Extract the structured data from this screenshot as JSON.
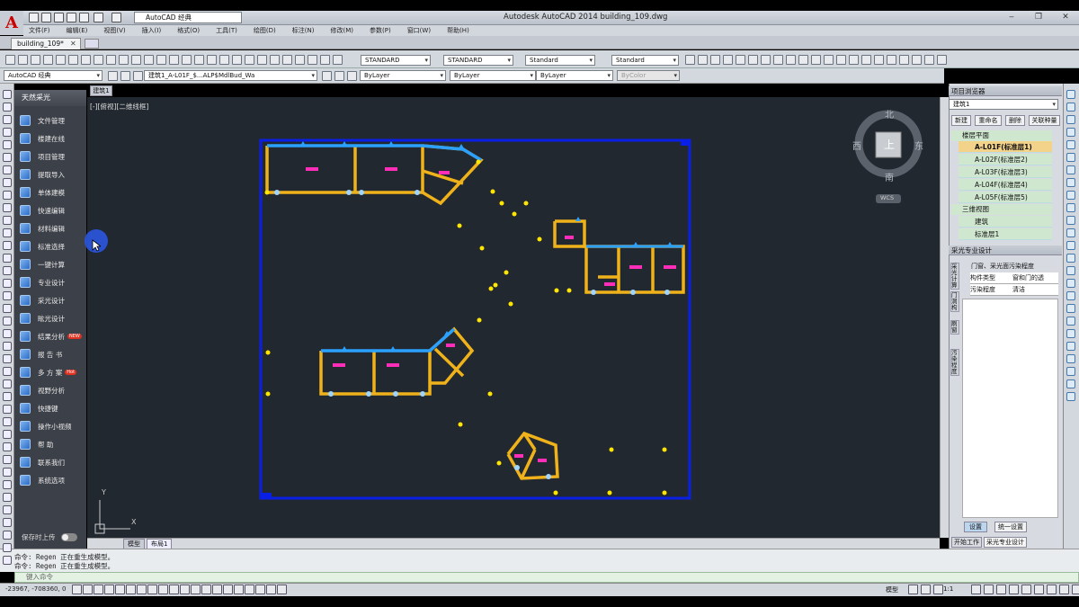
{
  "app": {
    "title": "Autodesk AutoCAD 2014    building_109.dwg",
    "workspace": "AutoCAD 经典",
    "doc_tab": "building_109*"
  },
  "menu": [
    "文件(F)",
    "编辑(E)",
    "视图(V)",
    "插入(I)",
    "格式(O)",
    "工具(T)",
    "绘图(D)",
    "标注(N)",
    "修改(M)",
    "参数(P)",
    "窗口(W)",
    "帮助(H)"
  ],
  "toolbar": {
    "text_style": "STANDARD",
    "dim_style": "STANDARD",
    "table_style": "Standard",
    "mleader_style": "Standard",
    "workspace2": "AutoCAD 经典",
    "layer": "建筑1_A-L01F_$...ALP$MdlBud_Wa",
    "color": "ByLayer",
    "linetype": "ByLayer",
    "lineweight": "ByLayer",
    "plotstyle": "ByColor"
  },
  "tangent_panel": {
    "header": "天然采光",
    "items": [
      {
        "label": "文件管理",
        "badge": ""
      },
      {
        "label": "楼建在线",
        "badge": ""
      },
      {
        "label": "项目管理",
        "badge": ""
      },
      {
        "label": "提取导入",
        "badge": ""
      },
      {
        "label": "单体建模",
        "badge": ""
      },
      {
        "label": "快速编辑",
        "badge": ""
      },
      {
        "label": "材料编辑",
        "badge": ""
      },
      {
        "label": "标准选择",
        "badge": ""
      },
      {
        "label": "一键计算",
        "badge": ""
      },
      {
        "label": "专业设计",
        "badge": ""
      },
      {
        "label": "采光设计",
        "badge": ""
      },
      {
        "label": "眩光设计",
        "badge": ""
      },
      {
        "label": "结果分析",
        "badge": "NEW"
      },
      {
        "label": "报 告 书",
        "badge": ""
      },
      {
        "label": "多 方 案",
        "badge": "Hot"
      },
      {
        "label": "视野分析",
        "badge": ""
      },
      {
        "label": "快捷键",
        "badge": ""
      },
      {
        "label": "操作小视频",
        "badge": ""
      },
      {
        "label": "帮    助",
        "badge": ""
      },
      {
        "label": "联系我们",
        "badge": ""
      },
      {
        "label": "系统选项",
        "badge": ""
      }
    ],
    "save_toggle_label": "保存时上传"
  },
  "viewport": {
    "tab": "建筑1",
    "label": "[-][俯视][二维线框]",
    "compass": {
      "north": "北",
      "south": "南",
      "east": "东",
      "west": "西",
      "top": "上",
      "wcs": "WCS"
    },
    "ucs_x": "X",
    "ucs_y": "Y"
  },
  "layout_tabs": {
    "model": "模型",
    "layout1": "布局1"
  },
  "command": {
    "line1": "命令: Regen 正在重生成模型。",
    "line2": "命令: Regen 正在重生成模型。",
    "input_placeholder": "键入命令"
  },
  "status": {
    "coords": "-23967, -708360, 0",
    "model_label": "模型",
    "scale": "A 1:1"
  },
  "project_browser": {
    "title": "项目浏览器",
    "combo": "建筑1",
    "buttons": [
      "新建",
      "重命名",
      "删除",
      "关联种量"
    ],
    "floor_group": "楼层平面",
    "floors": [
      "A-L01F(标准层1)",
      "A-L02F(标准层2)",
      "A-L03F(标准层3)",
      "A-L04F(标准层4)",
      "A-L05F(标准层5)"
    ],
    "view3d_group": "三维视图",
    "views3d": [
      "建筑",
      "标准层1"
    ]
  },
  "lighting_design": {
    "title": "采光专业设计",
    "side_tabs": [
      "采光计算",
      "门洞构",
      "刷窗",
      "污染程度"
    ],
    "group": "门窗、采光面污染程度",
    "rows": [
      {
        "key": "构件类型",
        "value": "窗和门的透"
      },
      {
        "key": "污染程度",
        "value": "清洁"
      }
    ],
    "buttons": [
      "设置",
      "统一设置"
    ],
    "bottom_tabs": [
      "开始工作",
      "采光专业设计"
    ]
  }
}
